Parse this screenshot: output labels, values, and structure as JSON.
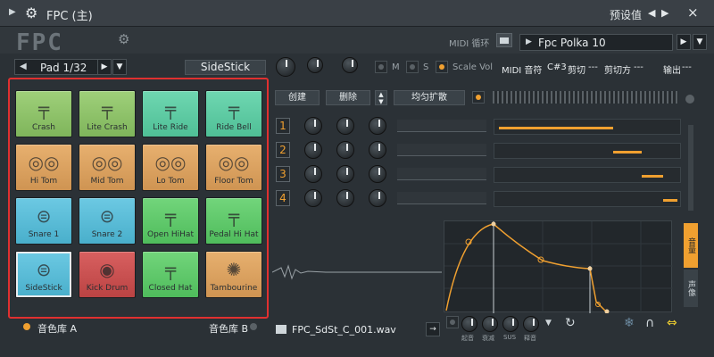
{
  "titlebar": {
    "title": "FPC (主)",
    "preset_label": "预设值",
    "close": "×"
  },
  "header": {
    "logo": "FPC",
    "midi_loop_label": "MIDI 循环",
    "preset_name": "Fpc Polka 10"
  },
  "pad_controls": {
    "pad_selector": "Pad 1/32",
    "selected_pad_name": "SideStick",
    "m_label": "M",
    "s_label": "S",
    "scale_vol_label": "Scale Vol"
  },
  "info": {
    "midi_note_label": "MIDI 音符",
    "midi_note_value": "C#3",
    "cut_label": "剪切",
    "cut_value": "---",
    "cut_by_label": "剪切方",
    "cut_by_value": "---",
    "output_label": "输出",
    "output_value": "---"
  },
  "pads": [
    {
      "name": "Crash",
      "icon": "cymbal-icon",
      "color": "green1"
    },
    {
      "name": "Lite Crash",
      "icon": "cymbal-icon",
      "color": "green1"
    },
    {
      "name": "Lite Ride",
      "icon": "cymbal-icon",
      "color": "teal"
    },
    {
      "name": "Ride Bell",
      "icon": "cymbal-icon",
      "color": "teal"
    },
    {
      "name": "Hi Tom",
      "icon": "tom-icon",
      "color": "orange"
    },
    {
      "name": "Mid Tom",
      "icon": "tom-icon",
      "color": "orange"
    },
    {
      "name": "Lo Tom",
      "icon": "tom-icon",
      "color": "orange"
    },
    {
      "name": "Floor Tom",
      "icon": "tom-icon",
      "color": "orange"
    },
    {
      "name": "Snare 1",
      "icon": "snare-icon",
      "color": "blue"
    },
    {
      "name": "Snare 2",
      "icon": "snare-icon",
      "color": "blue"
    },
    {
      "name": "Open HiHat",
      "icon": "hihat-icon",
      "color": "green2"
    },
    {
      "name": "Pedal Hi Hat",
      "icon": "hihat-icon",
      "color": "green2"
    },
    {
      "name": "SideStick",
      "icon": "snare-icon",
      "color": "blue",
      "selected": true
    },
    {
      "name": "Kick Drum",
      "icon": "kick-icon",
      "color": "red"
    },
    {
      "name": "Closed Hat",
      "icon": "hihat-icon",
      "color": "green2"
    },
    {
      "name": "Tambourine",
      "icon": "tambourine-icon",
      "color": "orange"
    }
  ],
  "banks": {
    "bank_a": "音色库 A",
    "bank_b": "音色库 B"
  },
  "layer_controls": {
    "create": "创建",
    "delete": "删除",
    "spread_even": "均匀扩散"
  },
  "layers": [
    {
      "num": "1",
      "range_from": 0.0,
      "range_to": 0.64
    },
    {
      "num": "2",
      "range_from": 0.64,
      "range_to": 0.8
    },
    {
      "num": "3",
      "range_from": 0.8,
      "range_to": 0.92
    },
    {
      "num": "4",
      "range_from": 0.92,
      "range_to": 1.0
    }
  ],
  "sample": {
    "filename": "FPC_SdSt_C_001.wav"
  },
  "envelope": {
    "knob_labels": [
      "起音",
      "衰减",
      "SUS",
      "释音"
    ],
    "side_tabs": [
      "音量",
      "声像"
    ]
  }
}
